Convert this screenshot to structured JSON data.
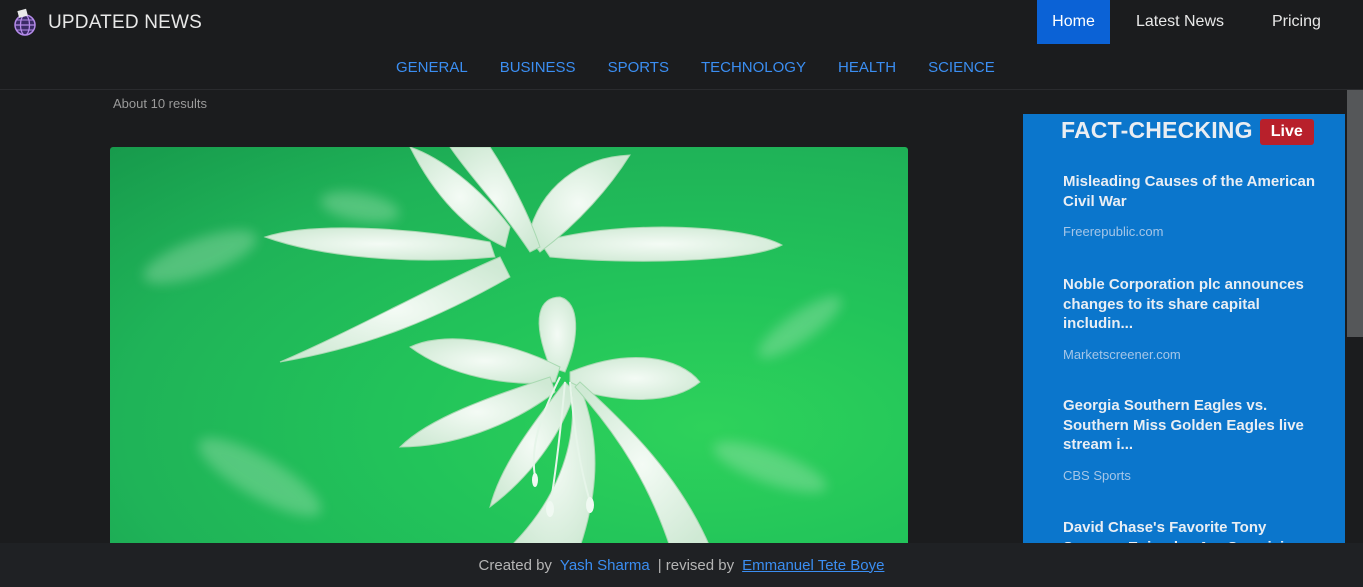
{
  "brand": {
    "name": "UPDATED NEWS",
    "logo_icon": "globe-newspaper-icon"
  },
  "nav": {
    "items": [
      "Home",
      "Latest News",
      "Pricing"
    ],
    "active": "Home"
  },
  "categories": [
    "GENERAL",
    "BUSINESS",
    "SPORTS",
    "TECHNOLOGY",
    "HEALTH",
    "SCIENCE"
  ],
  "results_text": "About 10 results",
  "hero": {
    "alt": "white lily flowers on green background",
    "tint": "#22c45a"
  },
  "sidebar": {
    "title": "FACT-CHECKING",
    "badge": "Live",
    "items": [
      {
        "title": "Misleading Causes of the American Civil War",
        "source": "Freerepublic.com"
      },
      {
        "title": "Noble Corporation plc announces changes to its share capital includin...",
        "source": "Marketscreener.com"
      },
      {
        "title": "Georgia Southern Eagles vs. Southern Miss Golden Eagles live stream i...",
        "source": "CBS Sports"
      },
      {
        "title": "David Chase's Favorite Tony Soprano Episodes Are Surprisin...",
        "source": ""
      }
    ]
  },
  "footer": {
    "created_by": "Created by",
    "author": "Yash Sharma",
    "revised_by": "| revised by",
    "reviser": "Emmanuel Tete Boye"
  },
  "colors": {
    "accent": "#0b62d6",
    "link": "#3b8ef2",
    "sidebar_bg": "#0b76cc",
    "live": "#b8202b"
  }
}
